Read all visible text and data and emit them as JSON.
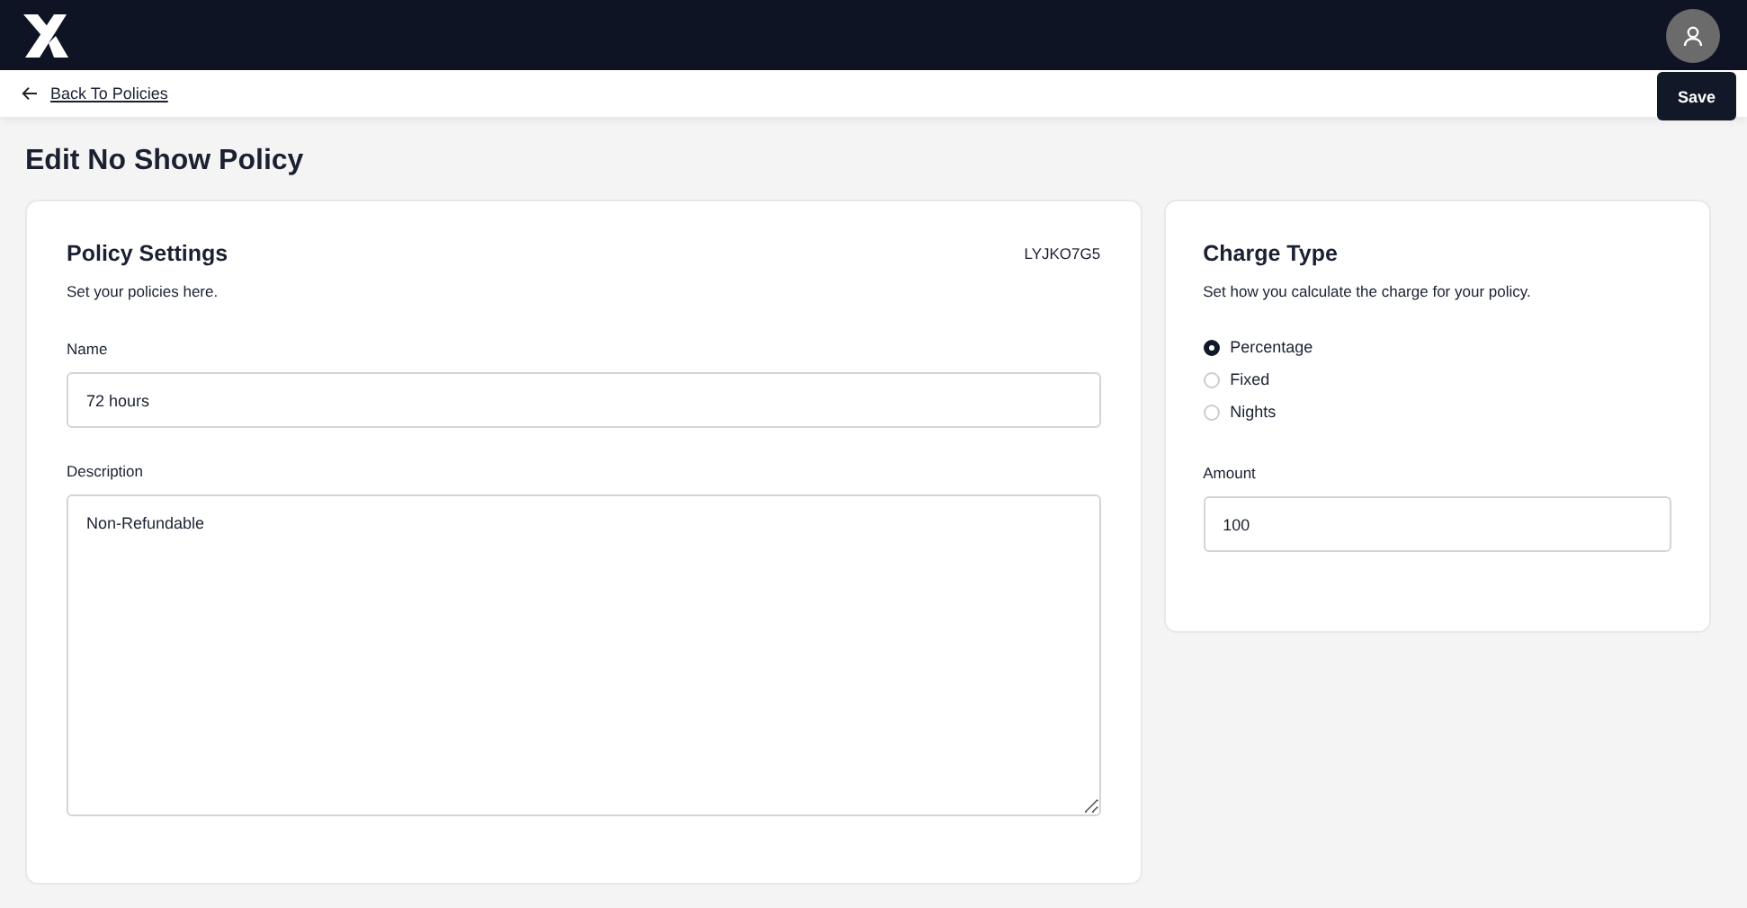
{
  "back_link": {
    "label": "Back To Policies"
  },
  "save_button": {
    "label": "Save"
  },
  "page_title": "Edit No Show Policy",
  "policy_settings": {
    "title": "Policy Settings",
    "code": "LYJKO7G5",
    "subtitle": "Set your policies here.",
    "fields": [
      {
        "kind": "input",
        "label": "Name",
        "value": "72 hours"
      },
      {
        "kind": "textarea",
        "label": "Description",
        "value": "Non-Refundable"
      }
    ]
  },
  "charge_type": {
    "title": "Charge Type",
    "subtitle": "Set how you calculate the charge for your policy.",
    "options": [
      {
        "label": "Percentage",
        "selected": true
      },
      {
        "label": "Fixed",
        "selected": false
      },
      {
        "label": "Nights",
        "selected": false
      }
    ],
    "amount": {
      "label": "Amount",
      "value": "100"
    }
  }
}
